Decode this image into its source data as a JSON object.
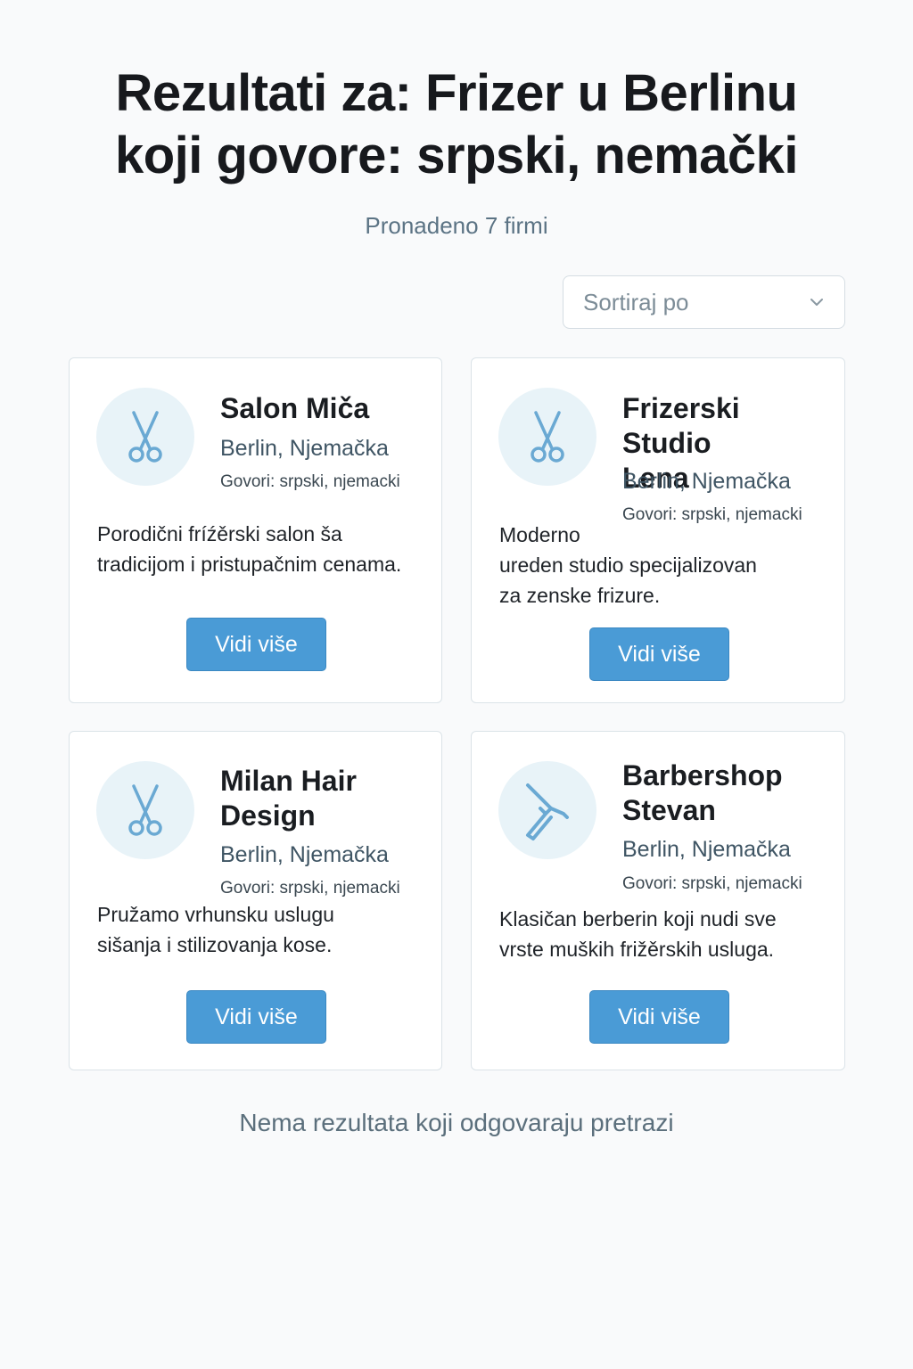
{
  "header": {
    "title_line1": "Rezultati za: Frizer u Berlinu",
    "title_line2": "koji govore: srpski, nemački",
    "count": "Pronadeno 7 firmi"
  },
  "sort": {
    "label": "Sortiraj po",
    "icon": "chevron-down-icon"
  },
  "colors": {
    "accent": "#4a9bd6",
    "icon": "#6aa9d3",
    "avatar_bg": "#e8f3f8"
  },
  "cards": [
    {
      "icon": "scissors-icon",
      "name": "Salon Miča",
      "location": "Berlin, Njemačka",
      "languages": "Govori: srpski, njemacki",
      "description_line1": "Porodični fríźěrski salon ša",
      "description_line2": "tradicijom i pristupačnim cenama.",
      "description_line3": "",
      "button": "Vidi više"
    },
    {
      "icon": "scissors-icon",
      "name_line1": "Frizerski Studio",
      "name_line2": "Lena",
      "location": "Berlin, Njemačka",
      "languages": "Govori: srpski, njemacki",
      "description_line1": "Moderno",
      "description_line2": "ureden studio specijalizovan",
      "description_line3": "za zenske frizure.",
      "button": "Vidi više"
    },
    {
      "icon": "scissors-icon",
      "name_line1": "Milan Hair",
      "name_line2": "Design",
      "location": "Berlin, Njemačka",
      "languages": "Govori: srpski, njemacki",
      "description_line1": "Pružamo vrhunsku uslugu",
      "description_line2": "sišanja i stilizovanja kose.",
      "button": "Vidi više"
    },
    {
      "icon": "razor-icon",
      "name_line1": "Barbershop",
      "name_line2": "Stevan",
      "location": "Berlin, Njemačka",
      "languages": "Govori: srpski, njemacki",
      "description_line1": "Klasičan berberin koji nudi sve",
      "description_line2": "vrste muških frižěrskih usluga.",
      "button": "Vidi više"
    }
  ],
  "footer": {
    "empty": "Nema rezultata koji odgovaraju pretrazi"
  }
}
